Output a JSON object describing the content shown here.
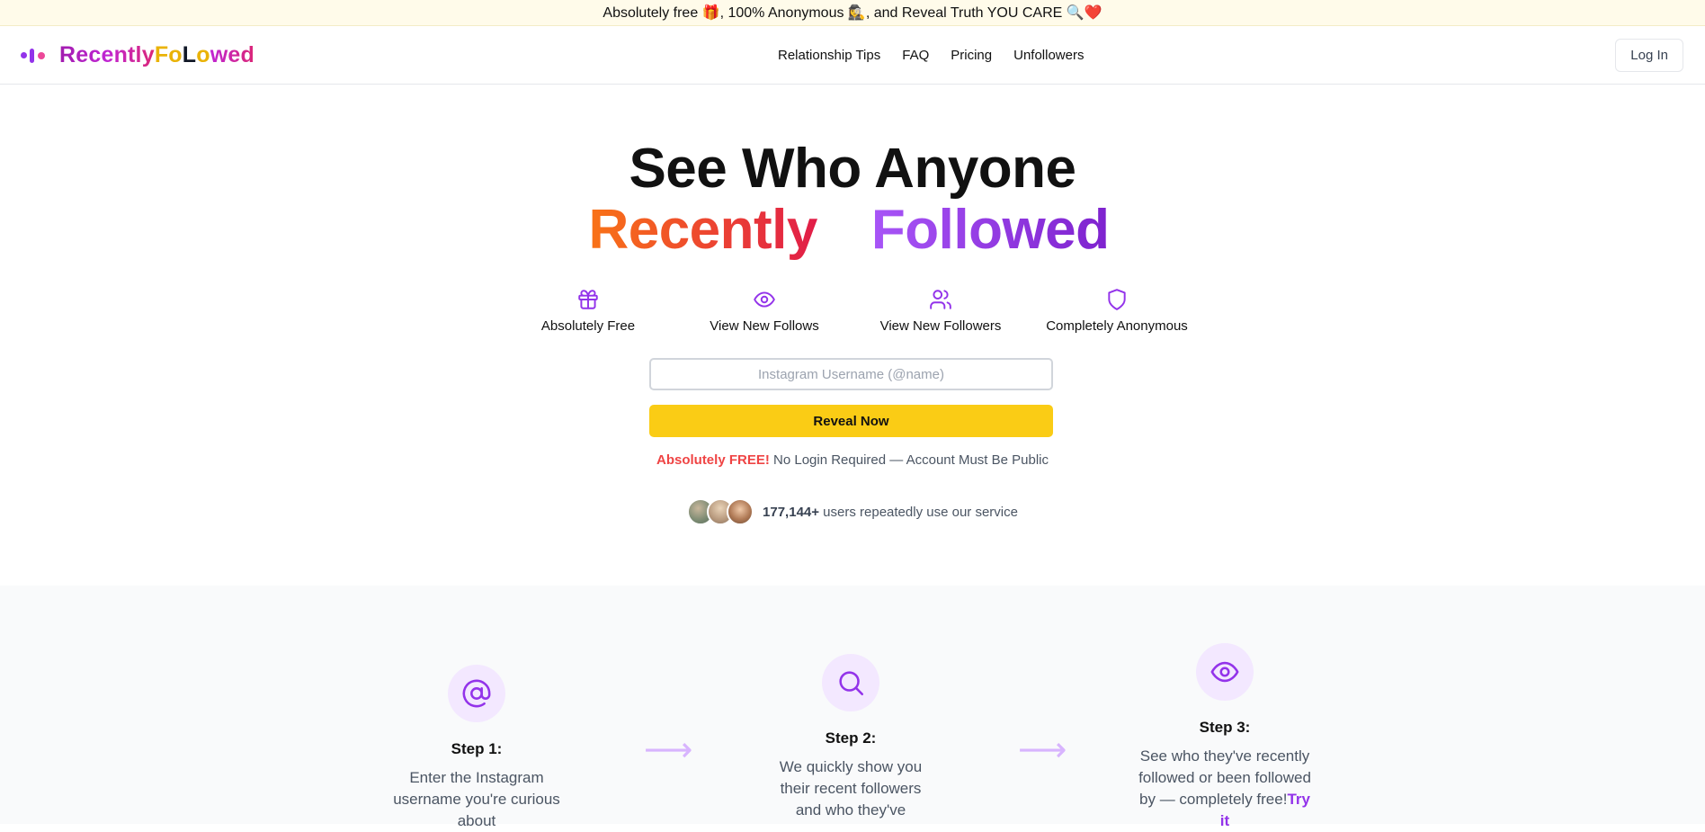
{
  "announcement": {
    "text": "Absolutely free 🎁, 100% Anonymous 🕵️‍♀️, and Reveal Truth YOU CARE 🔍❤️"
  },
  "header": {
    "logo": {
      "part_a": "Recently",
      "part_b": "Fo",
      "part_c": "L",
      "part_d": "o",
      "part_e": "wed"
    },
    "nav": [
      "Relationship Tips",
      "FAQ",
      "Pricing",
      "Unfollowers"
    ],
    "login_label": "Log In"
  },
  "hero": {
    "line1": "See Who Anyone",
    "word_recently": "Recently",
    "word_followed": "Followed",
    "features": [
      {
        "icon": "gift-icon",
        "label": "Absolutely Free"
      },
      {
        "icon": "eye-icon",
        "label": "View New Follows"
      },
      {
        "icon": "users-icon",
        "label": "View New Followers"
      },
      {
        "icon": "shield-icon",
        "label": "Completely Anonymous"
      }
    ],
    "input_placeholder": "Instagram Username (@name)",
    "input_value": "",
    "reveal_label": "Reveal Now",
    "free_note_bold": "Absolutely FREE!",
    "free_note_rest": " No Login Required — Account Must Be Public",
    "users_count": "177,144+",
    "users_text": " users repeatedly use our service"
  },
  "steps": [
    {
      "icon": "at-sign-icon",
      "title": "Step 1:",
      "text": "Enter the Instagram username you're curious about"
    },
    {
      "icon": "search-icon",
      "title": "Step 2:",
      "text": "We quickly show you their recent followers and who they've"
    },
    {
      "icon": "eye-icon",
      "title": "Step 3:",
      "text": "See who they've recently followed or been followed by — completely free!",
      "link": "Try it"
    }
  ],
  "step_arrow": "⟶",
  "colors": {
    "accent_purple": "#9333ea",
    "button_yellow": "#facc15",
    "red": "#ef4444",
    "announcement_bg": "#fffbea"
  }
}
